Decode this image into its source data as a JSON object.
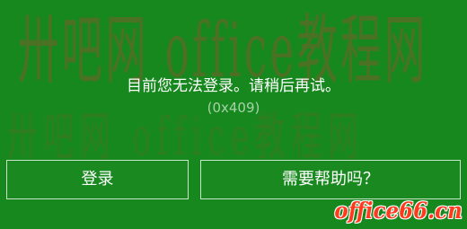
{
  "dialog": {
    "message": "目前您无法登录。请稍后再试。",
    "error_code": "(0x409)",
    "primary_button": "登录",
    "secondary_button": "需要帮助吗？"
  },
  "watermarks": {
    "main": "卅吧网 office教程网",
    "site": "office66.cn"
  },
  "colors": {
    "background": "#17861d",
    "text": "#ffffff",
    "button_border": "#ffffff",
    "watermark": "#965231",
    "site_watermark": "#ff3a1f"
  }
}
